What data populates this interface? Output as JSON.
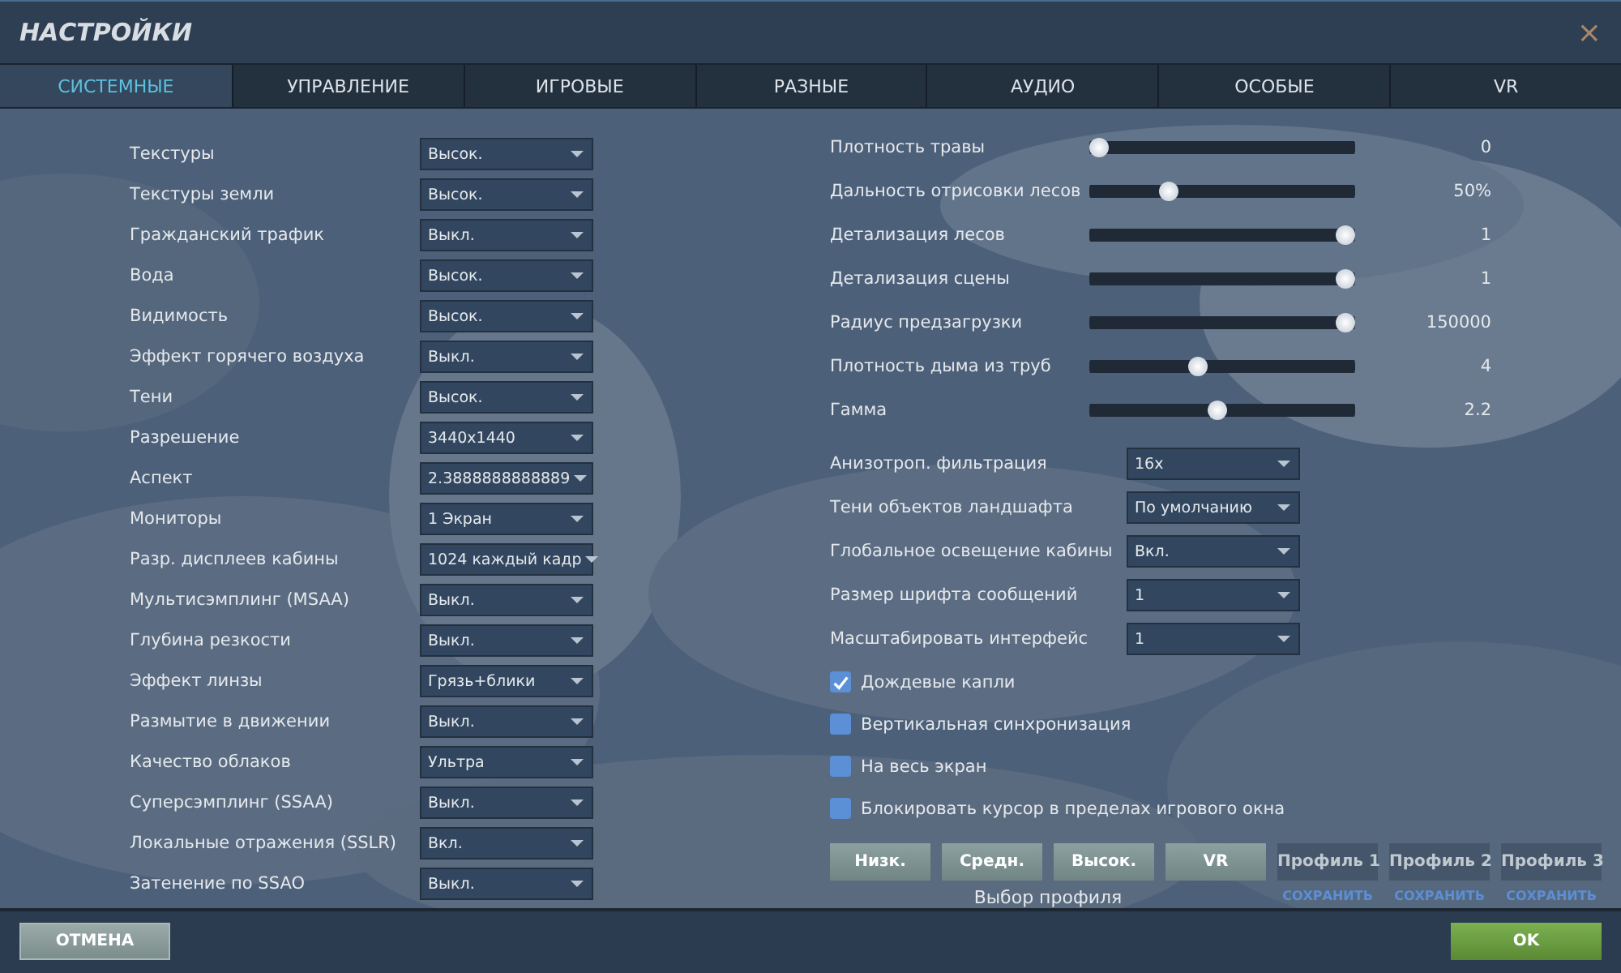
{
  "window": {
    "title": "НАСТРОЙКИ",
    "close": "×"
  },
  "tabs": [
    {
      "label": "СИСТЕМНЫЕ",
      "selected": true
    },
    {
      "label": "УПРАВЛЕНИЕ",
      "selected": false
    },
    {
      "label": "ИГРОВЫЕ",
      "selected": false
    },
    {
      "label": "РАЗНЫЕ",
      "selected": false
    },
    {
      "label": "АУДИО",
      "selected": false
    },
    {
      "label": "ОСОБЫЕ",
      "selected": false
    },
    {
      "label": "VR",
      "selected": false
    }
  ],
  "left_settings": [
    {
      "label": "Текстуры",
      "value": "Высок."
    },
    {
      "label": "Текстуры земли",
      "value": "Высок."
    },
    {
      "label": "Гражданский трафик",
      "value": "Выкл."
    },
    {
      "label": "Вода",
      "value": "Высок."
    },
    {
      "label": "Видимость",
      "value": "Высок."
    },
    {
      "label": "Эффект горячего воздуха",
      "value": "Выкл."
    },
    {
      "label": "Тени",
      "value": "Высок."
    },
    {
      "label": "Разрешение",
      "value": "3440x1440"
    },
    {
      "label": "Аспект",
      "value": "2.3888888888889"
    },
    {
      "label": "Мониторы",
      "value": "1 Экран"
    },
    {
      "label": "Разр. дисплеев кабины",
      "value": "1024 каждый кадр"
    },
    {
      "label": "Мультисэмплинг (MSAA)",
      "value": "Выкл."
    },
    {
      "label": "Глубина резкости",
      "value": "Выкл."
    },
    {
      "label": "Эффект линзы",
      "value": "Грязь+блики"
    },
    {
      "label": "Размытие в движении",
      "value": "Выкл."
    },
    {
      "label": "Качество облаков",
      "value": "Ультра"
    },
    {
      "label": "Суперсэмплинг (SSAA)",
      "value": "Выкл."
    },
    {
      "label": "Локальные отражения (SSLR)",
      "value": "Вкл."
    },
    {
      "label": "Затенение по SSAO",
      "value": "Выкл."
    }
  ],
  "sliders": [
    {
      "label": "Плотность травы",
      "level": 0,
      "reading": "0"
    },
    {
      "label": "Дальность отрисовки лесов",
      "level": 0.28,
      "reading": "50%"
    },
    {
      "label": "Детализация лесов",
      "level": 1,
      "reading": "1"
    },
    {
      "label": "Детализация сцены",
      "level": 1,
      "reading": "1"
    },
    {
      "label": "Радиус предзагрузки",
      "level": 1,
      "reading": "150000"
    },
    {
      "label": "Плотность дыма из труб",
      "level": 0.4,
      "reading": "4"
    },
    {
      "label": "Гамма",
      "level": 0.48,
      "reading": "2.2"
    }
  ],
  "right_settings": [
    {
      "label": "Анизотроп. фильтрация",
      "value": "16x"
    },
    {
      "label": "Тени объектов ландшафта",
      "value": "По умолчанию"
    },
    {
      "label": "Глобальное освещение кабины",
      "value": "Вкл."
    },
    {
      "label": "Размер шрифта сообщений",
      "value": "1"
    },
    {
      "label": "Масштабировать интерфейс",
      "value": "1"
    }
  ],
  "checkboxes": [
    {
      "label": "Дождевые капли",
      "checked": true
    },
    {
      "label": "Вертикальная синхронизация",
      "checked": false
    },
    {
      "label": "На весь экран",
      "checked": false
    },
    {
      "label": "Блокировать курсор в пределах игрового окна",
      "checked": false
    }
  ],
  "profiles": [
    {
      "label": "Низк.",
      "kind": "preset"
    },
    {
      "label": "Средн.",
      "kind": "preset"
    },
    {
      "label": "Высок.",
      "kind": "preset"
    },
    {
      "label": "VR",
      "kind": "preset"
    },
    {
      "label": "Профиль 1",
      "kind": "custom",
      "save": "СОХРАНИТЬ"
    },
    {
      "label": "Профиль 2",
      "kind": "custom",
      "save": "СОХРАНИТЬ"
    },
    {
      "label": "Профиль 3",
      "kind": "custom",
      "save": "СОХРАНИТЬ"
    }
  ],
  "profile_caption": "Выбор профиля",
  "footer": {
    "cancel": "ОТМЕНА",
    "ok": "OK"
  }
}
